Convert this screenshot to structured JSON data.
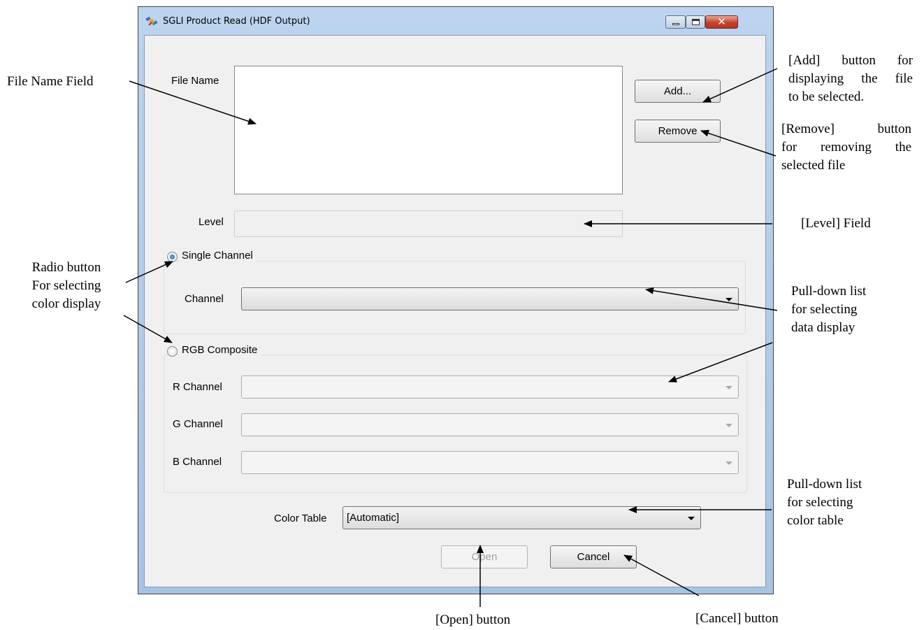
{
  "window": {
    "title": "SGLI Product Read (HDF Output)",
    "icons": {
      "app": "satellite-icon",
      "minimize": "minimize-icon",
      "maximize": "maximize-icon",
      "close": "close-icon"
    },
    "close_glyph": "✕"
  },
  "form": {
    "file_name_label": "File Name",
    "file_list_items": [],
    "add_button": "Add...",
    "remove_button": "Remove",
    "level_label": "Level",
    "level_value": "",
    "single_channel": {
      "label": "Single Channel",
      "selected": true,
      "channel_label": "Channel",
      "channel_value": ""
    },
    "rgb_composite": {
      "label": "RGB Composite",
      "selected": false,
      "r_label": "R Channel",
      "g_label": "G Channel",
      "b_label": "B Channel",
      "r_value": "",
      "g_value": "",
      "b_value": ""
    },
    "color_table_label": "Color Table",
    "color_table_value": "[Automatic]",
    "open_button": "Open",
    "cancel_button": "Cancel"
  },
  "annotations": {
    "file_name_field": "File Name Field",
    "add_button": [
      "[Add] button for",
      "displaying the file",
      "to be selected."
    ],
    "remove_button": [
      "[Remove] button",
      "for removing the",
      "selected file"
    ],
    "level_field": "[Level] Field",
    "radio_button": [
      "Radio button",
      "For selecting",
      "color display"
    ],
    "pulldown_data": [
      "Pull-down list",
      "for selecting",
      "data display"
    ],
    "pulldown_color": [
      "Pull-down list",
      "for selecting",
      "color table"
    ],
    "open_button": "[Open] button",
    "cancel_button": "[Cancel] button"
  }
}
